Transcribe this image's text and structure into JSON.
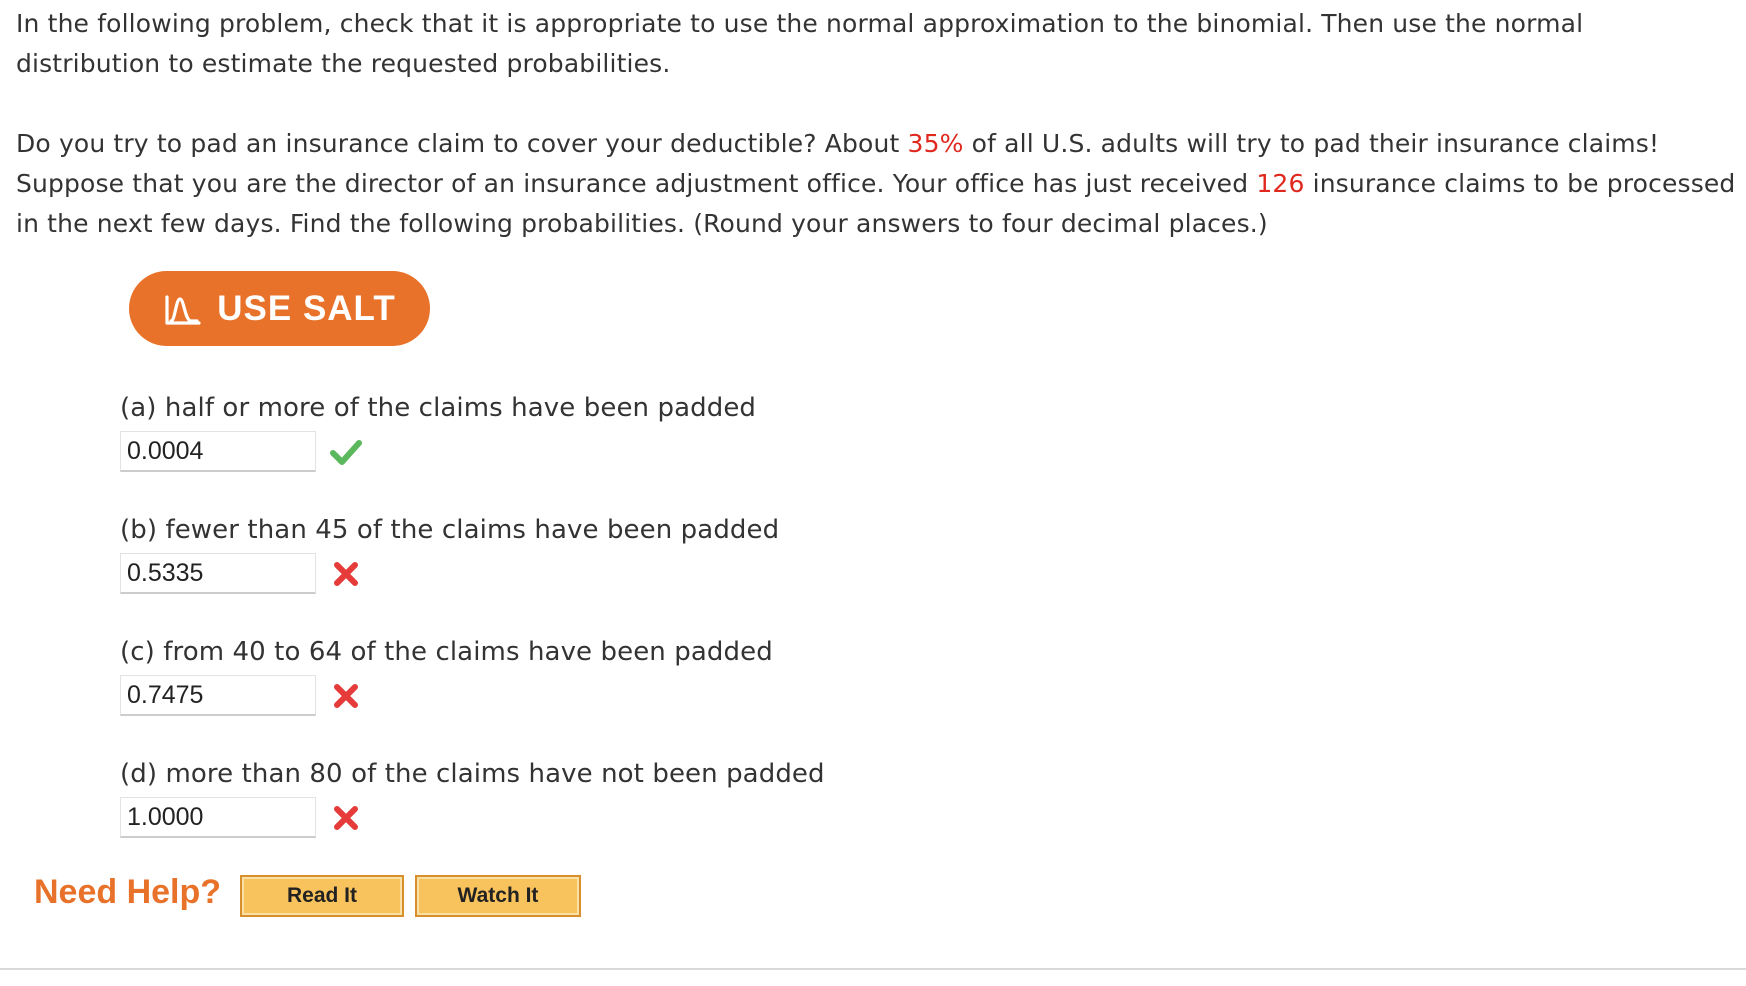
{
  "intro": {
    "text": "In the following problem, check that it is appropriate to use the normal approximation to the binomial. Then use the normal distribution to estimate the requested probabilities."
  },
  "problem": {
    "part1": "Do you try to pad an insurance claim to cover your deductible? About ",
    "percent": "35%",
    "part2": " of all U.S. adults will try to pad their insurance claims! Suppose that you are the director of an insurance adjustment office. Your office has just received ",
    "claims": "126",
    "part3": " insurance claims to be processed in the next few days. Find the following probabilities. (Round your answers to four decimal places.)"
  },
  "salt_button": {
    "label": "USE SALT",
    "icon": "salt-bell-curve-icon"
  },
  "questions": [
    {
      "label": "(a) half or more of the claims have been padded",
      "value": "0.0004",
      "status": "correct"
    },
    {
      "label": "(b) fewer than 45 of the claims have been padded",
      "value": "0.5335",
      "status": "incorrect"
    },
    {
      "label": "(c) from 40 to 64 of the claims have been padded",
      "value": "0.7475",
      "status": "incorrect"
    },
    {
      "label": "(d) more than 80 of the claims have not been padded",
      "value": "1.0000",
      "status": "incorrect"
    }
  ],
  "help": {
    "title": "Need Help?",
    "read_label": "Read It",
    "watch_label": "Watch It"
  },
  "colors": {
    "accent_orange": "#e8722a",
    "highlight_red": "#e0281e",
    "correct_green": "#5cb85c",
    "incorrect_red": "#e53b3b",
    "help_button_fill": "#f8c25c"
  }
}
